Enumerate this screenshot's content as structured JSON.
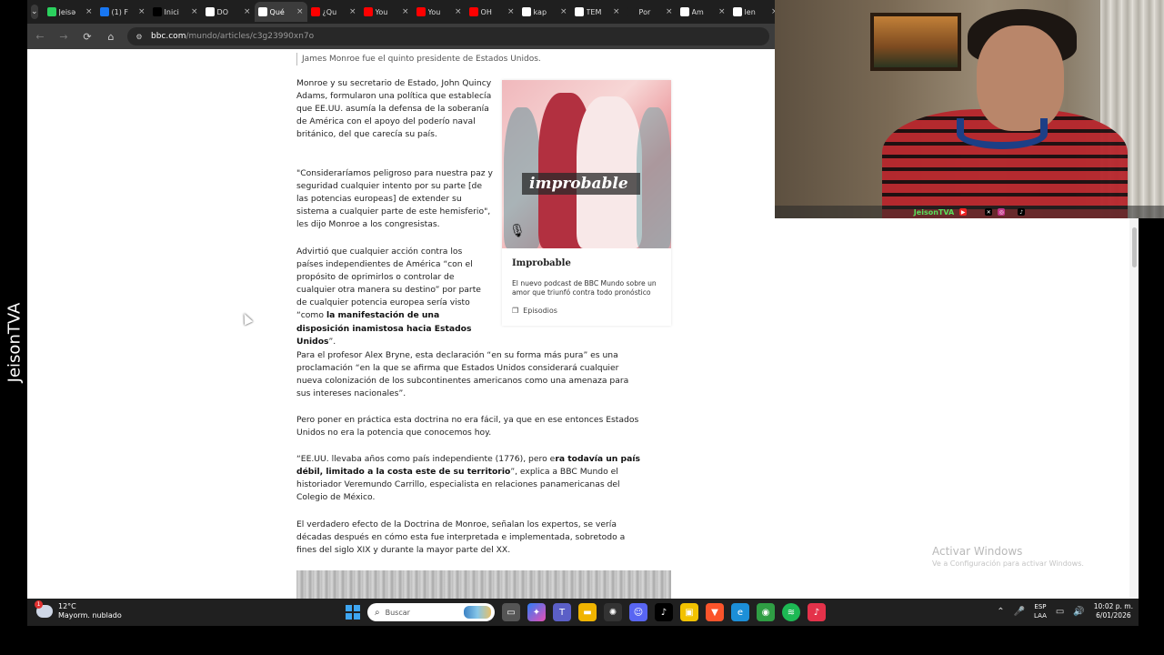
{
  "browser": {
    "tabs": [
      {
        "label": "Jeisə",
        "color": "#2bd15e",
        "active": false
      },
      {
        "label": "(1) F",
        "color": "#1877f2",
        "active": false
      },
      {
        "label": "Inici",
        "color": "#000000",
        "active": false
      },
      {
        "label": "DO",
        "color": "#ffffff",
        "active": false
      },
      {
        "label": "Qué",
        "color": "#ffffff",
        "active": true
      },
      {
        "label": "¿Qu",
        "color": "#ff0000",
        "active": false
      },
      {
        "label": "You",
        "color": "#ff0000",
        "active": false
      },
      {
        "label": "You",
        "color": "#ff0000",
        "active": false
      },
      {
        "label": "OH",
        "color": "#ff0000",
        "active": false
      },
      {
        "label": "kap",
        "color": "#ffffff",
        "active": false
      },
      {
        "label": "TEM",
        "color": "#ffffff",
        "active": false
      },
      {
        "label": "Por",
        "color": "#1f1f1f",
        "active": false
      },
      {
        "label": "Am",
        "color": "#ffffff",
        "active": false
      },
      {
        "label": "len",
        "color": "#ffffff",
        "active": false
      }
    ],
    "url_domain": "bbc.com",
    "url_path": "/mundo/articles/c3g23990xn7o"
  },
  "article": {
    "caption": "James Monroe fue el quinto presidente de Estados Unidos.",
    "p1": "Monroe y su secretario de Estado, John Quincy Adams, formularon una política que establecía que EE.UU. asumía la defensa de la soberanía de América con el apoyo del poderío naval británico, del que carecía su país.",
    "p2": "\"Consideraríamos peligroso para nuestra paz y seguridad cualquier intento por su parte [de las potencias europeas] de extender su sistema a cualquier parte de este hemisferio\", les dijo Monroe a los congresistas.",
    "p3_a": "Advirtió que cualquier acción contra los países independientes de América “con el propósito de oprimirlos o controlar de cualquier otra manera su destino” por parte de cualquier potencia europea sería visto “como ",
    "p3_b": "la manifestación de una disposición inamistosa hacia Estados Unidos",
    "p3_c": "”.",
    "p4": "Para el profesor Alex Bryne, esta declaración “en su forma más pura” es una proclamación “en la que se afirma que Estados Unidos considerará cualquier nueva colonización de los subcontinentes americanos como una amenaza para sus intereses nacionales”.",
    "p5": "Pero poner en práctica esta doctrina no era fácil, ya que en ese entonces Estados Unidos no era la potencia que conocemos hoy.",
    "p6_a": "“EE.UU. llevaba años como país independiente (1776), pero e",
    "p6_b": "ra todavía un país débil, limitado a la costa este de su territorio",
    "p6_c": "”, explica a BBC Mundo el historiador Veremundo Carrillo, especialista en relaciones panamericanas del Colegio de México.",
    "p7": "El verdadero efecto de la Doctrina de Monroe, señalan los expertos, se vería décadas después en cómo esta fue interpretada e implementada, sobretodo a fines del siglo XIX y durante la mayor parte del XX."
  },
  "promo": {
    "image_text": "improbable",
    "title": "Improbable",
    "description": "El nuevo podcast de BBC Mundo sobre un amor que triunfó contra todo pronóstico",
    "episodes_label": "Episodios"
  },
  "watermark": {
    "title": "Activar Windows",
    "subtitle": "Ve a Configuración para activar Windows."
  },
  "side_label": "JeisonTVA",
  "webcam": {
    "name": "JeisonTVA"
  },
  "taskbar": {
    "weather_temp": "12°C",
    "weather_desc": "Mayorm. nublado",
    "weather_badge": "1",
    "search_placeholder": "Buscar",
    "lang_line1": "ESP",
    "lang_line2": "LAA",
    "time": "10:02 p. m.",
    "date": "6/01/2026"
  }
}
